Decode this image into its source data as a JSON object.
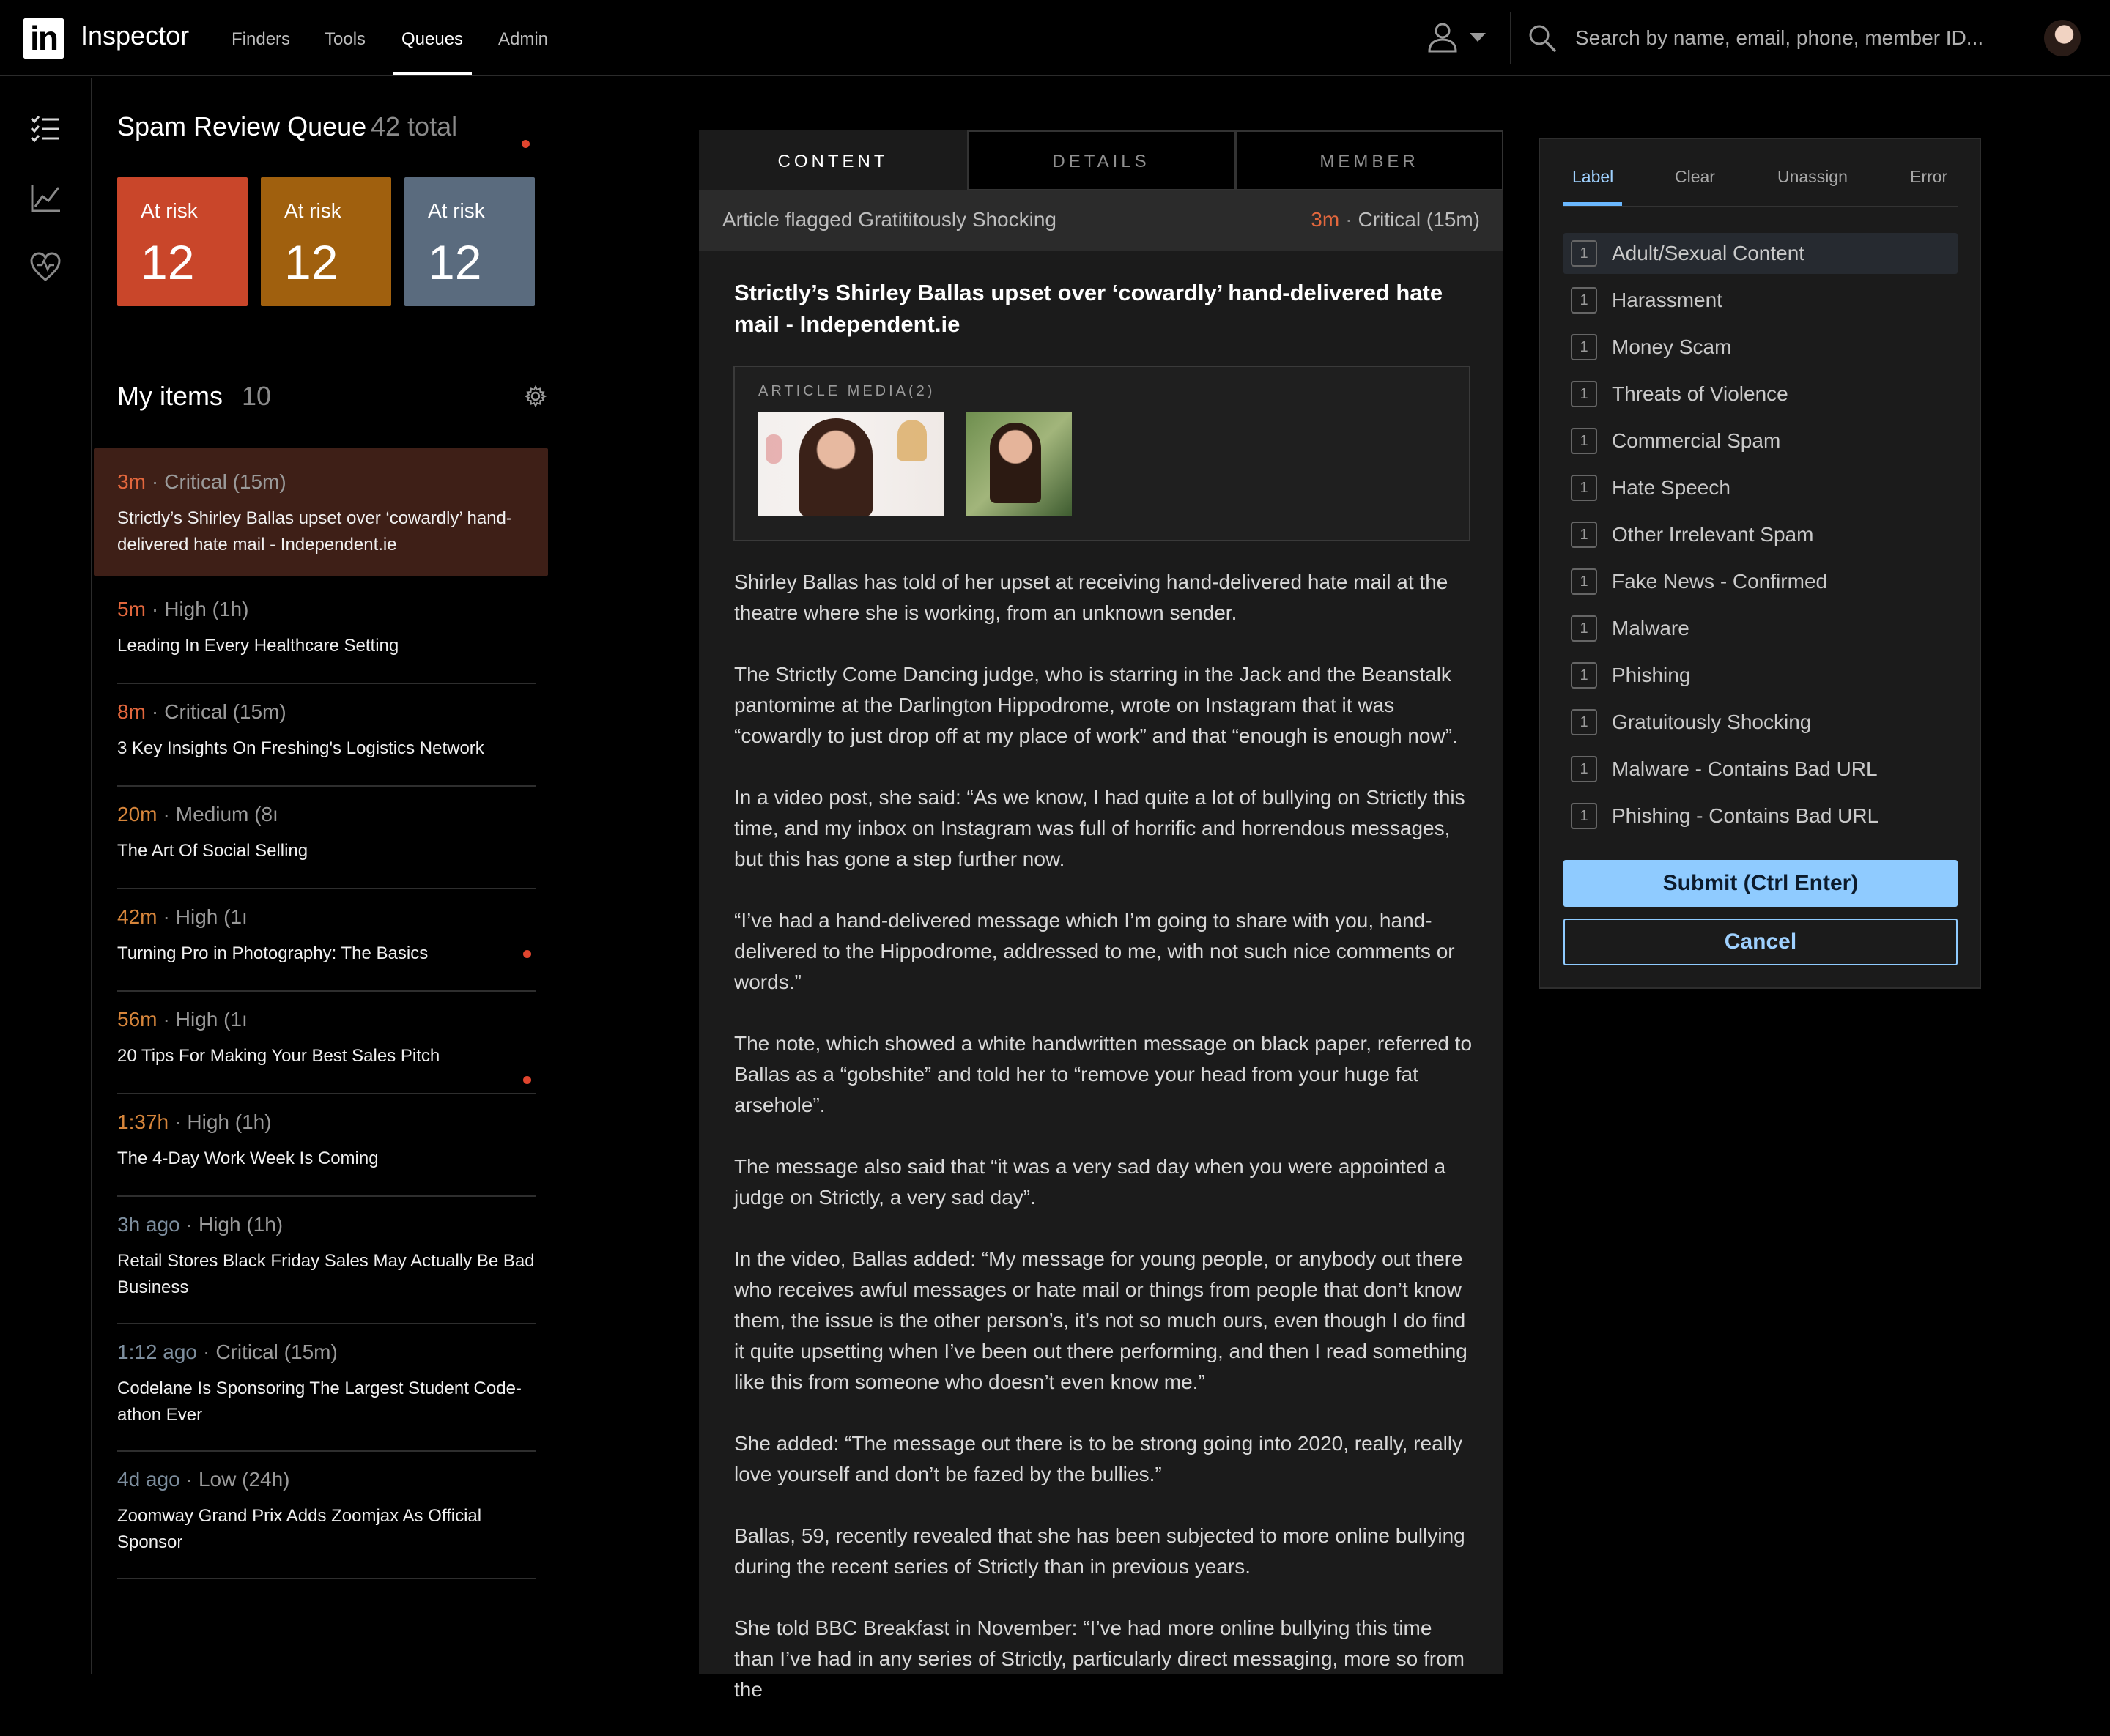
{
  "app": {
    "logo": "in",
    "title": "Inspector"
  },
  "nav": [
    {
      "label": "Finders",
      "active": false
    },
    {
      "label": "Tools",
      "active": false
    },
    {
      "label": "Queues",
      "active": true
    },
    {
      "label": "Admin",
      "active": false
    }
  ],
  "search": {
    "placeholder": "Search by name, email, phone, member ID..."
  },
  "icons": {
    "rail": [
      "checklist-icon",
      "analytics-chart-icon",
      "heart-icon"
    ],
    "top": [
      "user-icon",
      "chevron-down-icon",
      "search-icon",
      "avatar"
    ]
  },
  "queue": {
    "title": "Spam Review Queue",
    "total": "42 total",
    "risk_cards": [
      {
        "label": "At risk",
        "count": "12",
        "color": "#c9462a"
      },
      {
        "label": "At risk",
        "count": "12",
        "color": "#a0600e"
      },
      {
        "label": "At risk",
        "count": "12",
        "color": "#5a6b7e"
      }
    ],
    "my_items_label": "My items",
    "my_items_count": "10",
    "items": [
      {
        "time": "3m",
        "priority": "Critical (15m)",
        "title": "Strictly’s Shirley Ballas upset over ‘cowardly’ hand-delivered hate mail - Independent.ie",
        "selected": true,
        "flag": false,
        "tone": "hot"
      },
      {
        "time": "5m",
        "priority": "High (1h)",
        "title": "Leading In Every Healthcare Setting",
        "selected": false,
        "flag": false,
        "tone": "hot"
      },
      {
        "time": "8m",
        "priority": "Critical (15m)",
        "title": "3 Key Insights On Freshing's Logistics Network",
        "selected": false,
        "flag": false,
        "tone": "hot"
      },
      {
        "time": "20m",
        "priority": "Medium (8ı",
        "title": "The Art Of Social Selling",
        "selected": false,
        "flag": false,
        "tone": "med"
      },
      {
        "time": "42m",
        "priority": "High (1ı",
        "title": "Turning Pro in Photography: The Basics",
        "selected": false,
        "flag": true,
        "tone": "med"
      },
      {
        "time": "56m",
        "priority": "High (1ı",
        "title": "20 Tips For Making Your Best Sales Pitch",
        "selected": false,
        "flag": true,
        "tone": "med"
      },
      {
        "time": "1:37h",
        "priority": "High (1h)",
        "title": "The 4-Day Work Week Is Coming",
        "selected": false,
        "flag": false,
        "tone": "med"
      },
      {
        "time": "3h ago",
        "priority": "High (1h)",
        "title": "Retail Stores Black Friday Sales May Actually Be Bad Business",
        "selected": false,
        "flag": false,
        "tone": "grey"
      },
      {
        "time": "1:12 ago",
        "priority": "Critical (15m)",
        "title": "Codelane Is Sponsoring The Largest Student Code-athon Ever",
        "selected": false,
        "flag": false,
        "tone": "grey"
      },
      {
        "time": "4d ago",
        "priority": "Low (24h)",
        "title": "Zoomway Grand Prix Adds Zoomjax As Official Sponsor",
        "selected": false,
        "flag": false,
        "tone": "grey"
      }
    ]
  },
  "content": {
    "tabs": [
      "CONTENT",
      "DETAILS",
      "MEMBER"
    ],
    "active_tab": "CONTENT",
    "flag_text": "Article flagged Gratititously Shocking",
    "flag_time": "3m",
    "flag_priority": "Critical (15m)",
    "article_title": "Strictly’s Shirley Ballas upset over ‘cowardly’ hand-delivered hate mail - Independent.ie",
    "media_label": "ARTICLE MEDIA(2)",
    "paragraphs": [
      "Shirley Ballas has told of her upset at receiving hand-delivered hate mail at the theatre where she is working, from an unknown sender.",
      "The Strictly Come Dancing judge, who is starring in the Jack and the Beanstalk pantomime at the Darlington Hippodrome, wrote on Instagram that it was “cowardly to just drop off at my place of work” and that “enough is enough now”.",
      "In a video post, she said: “As we know, I had quite a lot of bullying on Strictly this time, and my inbox on Instagram was full of horrific and horrendous messages, but this has gone a step further now.",
      "“I’ve had a hand-delivered message which I’m going to share with you, hand-delivered to the Hippodrome, addressed to me, with not such nice comments or words.”",
      "The note, which showed a white handwritten message on black paper, referred to Ballas as a “gobshite” and told her to “remove your head from your huge fat arsehole”.",
      "The message also said that “it was a very sad day when you were appointed a judge on Strictly, a very sad day”.",
      "In the video, Ballas added: “My message for young people, or anybody out there who receives awful messages or hate mail or things from people that don’t know them, the issue is the other person’s, it’s not so much ours, even though I do find it quite upsetting when I’ve been out there performing, and then I read something like this from someone who doesn’t even know me.”",
      "She added: “The message out there is to be strong going into 2020, really, really love yourself and don’t be fazed by the bullies.”",
      "Ballas, 59, recently revealed that she has been subjected to more online bullying during the recent series of Strictly than in previous years.",
      "She told BBC Breakfast in November: “I’ve had more online bullying this time than I’ve had in any series of Strictly, particularly direct messaging, more so from the"
    ]
  },
  "panel": {
    "tabs": [
      "Label",
      "Clear",
      "Unassign",
      "Error"
    ],
    "active_tab": "Label",
    "labels": [
      {
        "key": "1",
        "text": "Adult/Sexual Content"
      },
      {
        "key": "1",
        "text": "Harassment"
      },
      {
        "key": "1",
        "text": "Money Scam"
      },
      {
        "key": "1",
        "text": "Threats of Violence"
      },
      {
        "key": "1",
        "text": "Commercial Spam"
      },
      {
        "key": "1",
        "text": "Hate Speech"
      },
      {
        "key": "1",
        "text": "Other Irrelevant Spam"
      },
      {
        "key": "1",
        "text": "Fake News - Confirmed"
      },
      {
        "key": "1",
        "text": "Malware"
      },
      {
        "key": "1",
        "text": "Phishing"
      },
      {
        "key": "1",
        "text": "Gratuitously Shocking"
      },
      {
        "key": "1",
        "text": "Malware - Contains Bad URL"
      },
      {
        "key": "1",
        "text": "Phishing - Contains Bad URL"
      }
    ],
    "submit_label": "Submit (Ctrl Enter)",
    "cancel_label": "Cancel"
  }
}
